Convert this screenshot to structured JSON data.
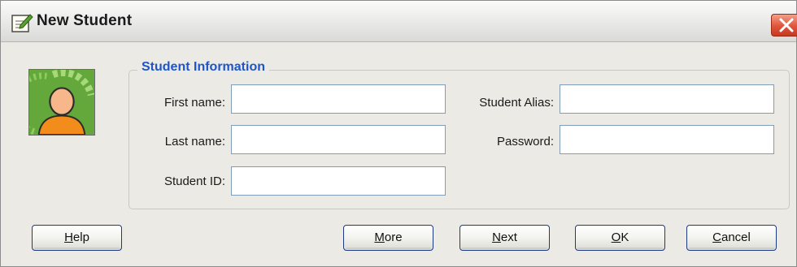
{
  "window": {
    "title": "New Student",
    "title_icon": "edit-document-icon",
    "close_icon": "close-icon"
  },
  "student_info": {
    "group_title": "Student Information",
    "first_name": {
      "label": "First name:",
      "value": ""
    },
    "last_name": {
      "label": "Last name:",
      "value": ""
    },
    "student_id": {
      "label": "Student ID:",
      "value": ""
    },
    "student_alias": {
      "label": "Student Alias:",
      "value": ""
    },
    "password": {
      "label": "Password:",
      "value": ""
    }
  },
  "avatar": {
    "icon": "student-avatar-icon"
  },
  "buttons": {
    "help": {
      "mnemonic": "H",
      "rest": "elp"
    },
    "more": {
      "mnemonic": "M",
      "rest": "ore"
    },
    "next": {
      "mnemonic": "N",
      "rest": "ext"
    },
    "ok": {
      "mnemonic": "O",
      "rest": "K"
    },
    "cancel": {
      "mnemonic": "C",
      "rest": "ancel"
    }
  },
  "colors": {
    "group_title": "#1f55c8",
    "close_button": "#e0543a",
    "avatar_background": "#64a83c",
    "avatar_figure": "#f28c1a"
  }
}
